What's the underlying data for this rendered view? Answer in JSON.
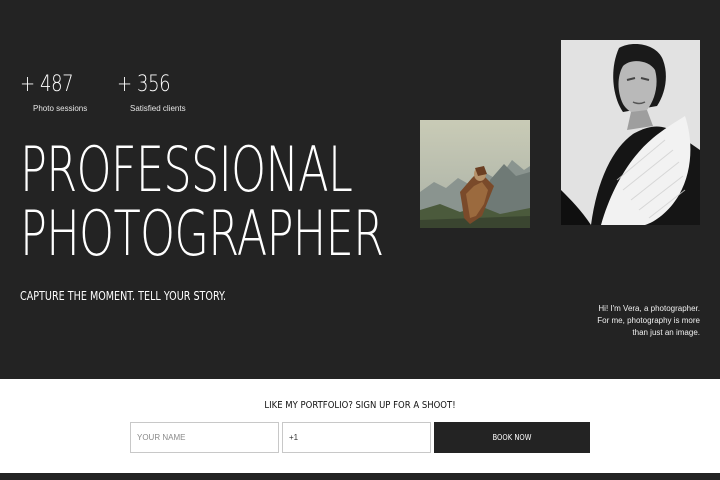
{
  "stats": [
    {
      "value": "+ 487",
      "label": "Photo sessions"
    },
    {
      "value": "+ 356",
      "label": "Satisfied clients"
    }
  ],
  "hero": {
    "headline_line1": "PROFESSIONAL",
    "headline_line2": "PHOTOGRAPHER",
    "tagline": "CAPTURE THE MOMENT. TELL YOUR STORY.",
    "intro_line1": "Hi! I'm Vera, a photographer.",
    "intro_line2": "For me, photography is more",
    "intro_line3": "than just an image."
  },
  "cta": {
    "title": "LIKE MY PORTFOLIO? SIGN UP FOR A SHOOT!",
    "name_placeholder": "YOUR NAME",
    "phone_value": "+1",
    "button_label": "BOOK NOW"
  },
  "colors": {
    "dark": "#232323",
    "light": "#ffffff"
  }
}
